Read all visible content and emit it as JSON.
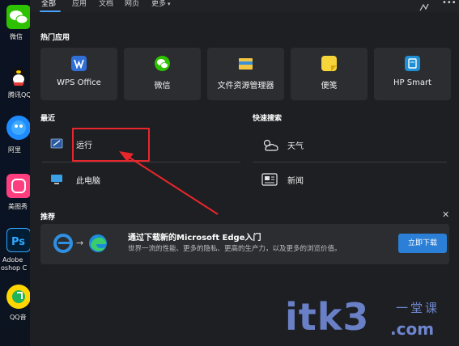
{
  "desktop": {
    "icons": [
      {
        "label": "微信",
        "icon": "wechat-icon",
        "color": "#2dc100"
      },
      {
        "label": "腾讯QQ",
        "icon": "qq-icon",
        "color": "#111111"
      },
      {
        "label": "阿里",
        "icon": "aliwangwang-icon",
        "color": "#1e8cff"
      },
      {
        "label": "美图秀",
        "icon": "meitu-icon",
        "color": "#ff3e7f"
      },
      {
        "label": "Adobe",
        "icon": "photoshop-icon",
        "color": "#001e36"
      },
      {
        "label": "oshop C",
        "icon": "photoshop-label-icon",
        "color": "#31a8ff"
      },
      {
        "label": "QQ音",
        "icon": "qqmusic-icon",
        "color": "#ffd600"
      }
    ]
  },
  "topbar": {
    "tabs": [
      "全部",
      "应用",
      "文档",
      "网页",
      "更多"
    ],
    "active_tab": "全部",
    "more_chevron": "▾",
    "right_icons": [
      "feedback-icon",
      "more-options-icon"
    ]
  },
  "pinned": {
    "title": "热门应用",
    "apps": [
      {
        "label": "WPS Office",
        "icon": "wps-icon",
        "color": "#2f6fd6"
      },
      {
        "label": "微信",
        "icon": "wechat-icon",
        "color": "#2dc100"
      },
      {
        "label": "文件资源管理器",
        "icon": "file-explorer-icon",
        "color": "#f4c542"
      },
      {
        "label": "便笺",
        "icon": "sticky-notes-icon",
        "color": "#f7d53a"
      },
      {
        "label": "HP Smart",
        "icon": "hp-smart-icon",
        "color": "#1f8fd6"
      }
    ]
  },
  "recent": {
    "title": "最近",
    "items": [
      {
        "label": "运行",
        "icon": "run-icon"
      },
      {
        "label": "此电脑",
        "icon": "this-pc-icon"
      }
    ]
  },
  "quick_search": {
    "title": "快速搜索",
    "items": [
      {
        "label": "天气",
        "icon": "weather-icon"
      },
      {
        "label": "新闻",
        "icon": "news-icon"
      }
    ]
  },
  "recommend": {
    "title": "推荐",
    "close": "✕",
    "card": {
      "title": "通过下载新的Microsoft Edge入门",
      "desc": "世界一流的性能、更多的隐私、更高的生产力，以及更多的浏览价值。",
      "button": "立即下载",
      "icons": [
        "ie-icon",
        "arrow-icon",
        "edge-icon"
      ]
    }
  },
  "watermark": {
    "text": "itk3",
    "suffix": ".com",
    "cn": "一堂课"
  },
  "colors": {
    "panel_bg": "#1d1f23",
    "tile_bg": "#2b2d31",
    "accent": "#2b7fd6",
    "highlight": "#e8262b"
  }
}
